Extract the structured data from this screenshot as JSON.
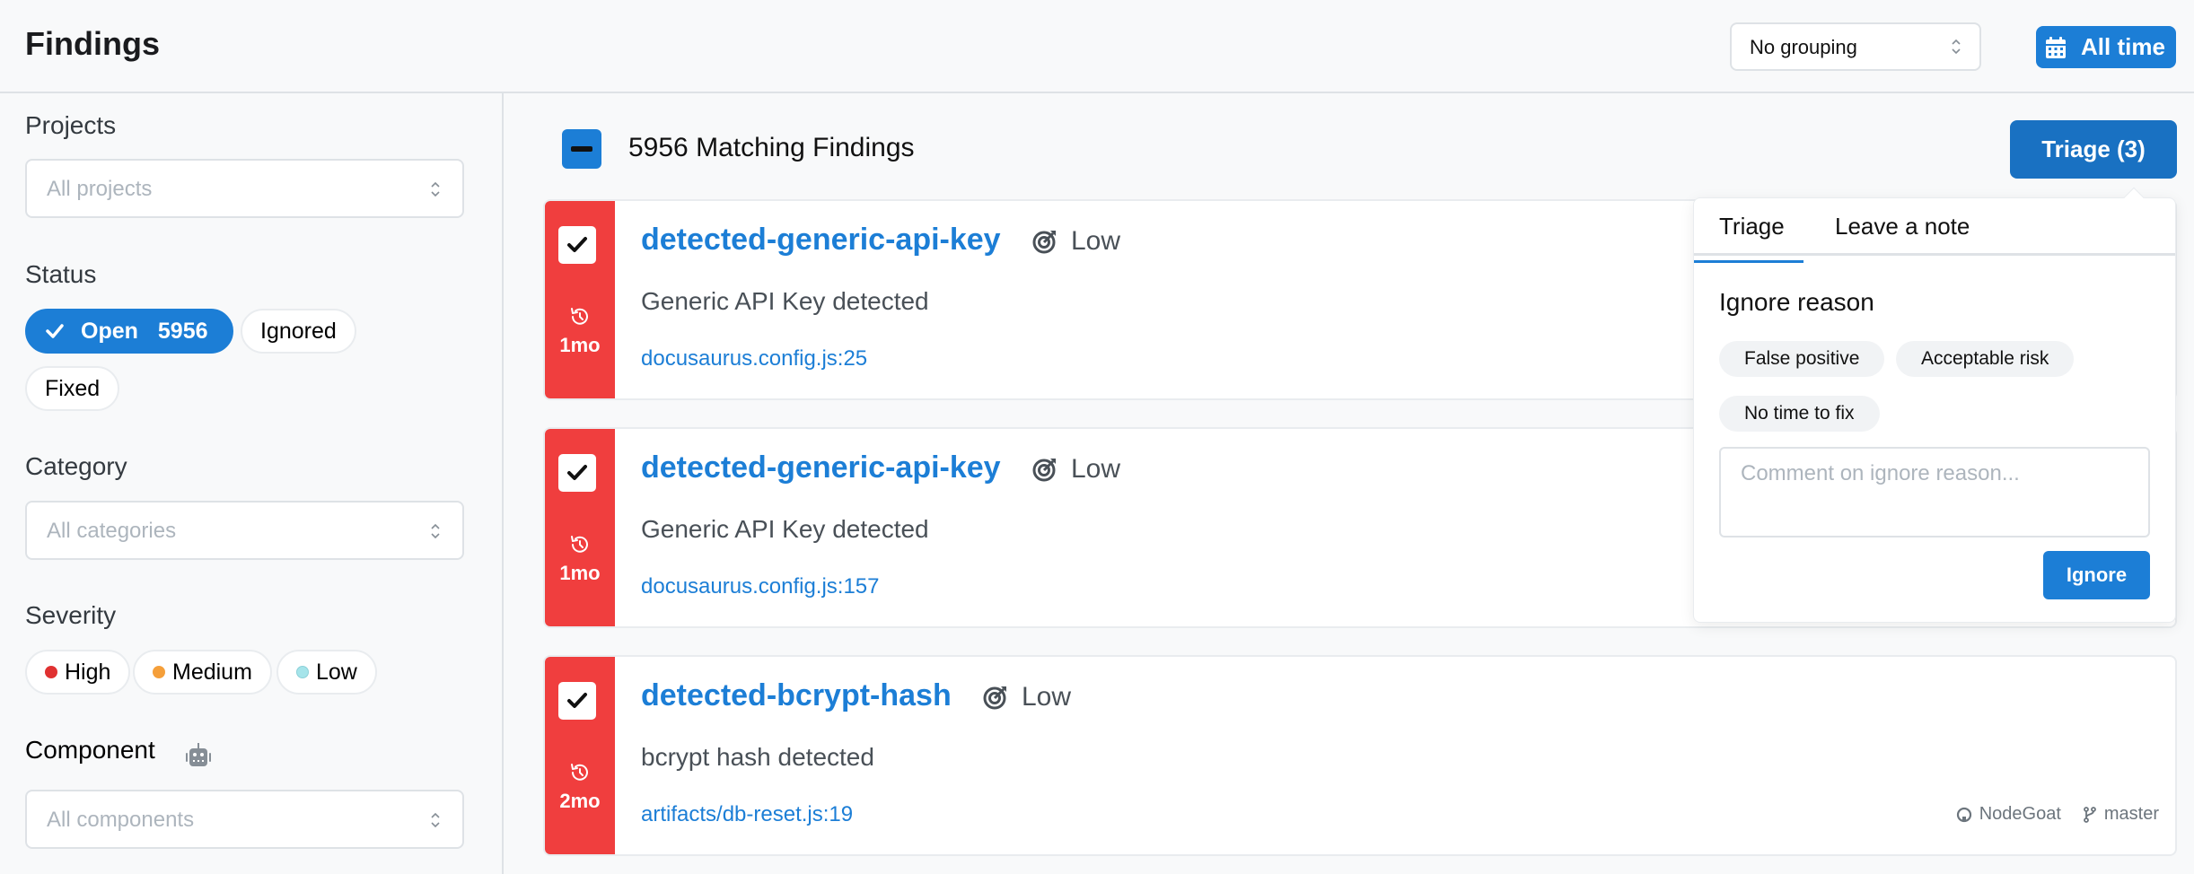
{
  "header": {
    "title": "Findings",
    "grouping": {
      "value": "No grouping"
    },
    "time_range": {
      "label": "All time",
      "icon": "calendar-icon"
    }
  },
  "sidebar": {
    "projects": {
      "label": "Projects",
      "placeholder": "All projects"
    },
    "status": {
      "label": "Status",
      "options": [
        {
          "label": "Open",
          "count": "5956",
          "selected": true
        },
        {
          "label": "Ignored",
          "selected": false
        },
        {
          "label": "Fixed",
          "selected": false
        }
      ]
    },
    "category": {
      "label": "Category",
      "placeholder": "All categories"
    },
    "severity": {
      "label": "Severity",
      "options": [
        {
          "label": "High",
          "color": "#e03131"
        },
        {
          "label": "Medium",
          "color": "#f59f00"
        },
        {
          "label": "Low",
          "color": "#99e9f2"
        }
      ]
    },
    "component": {
      "label": "Component",
      "icon": "robot-icon",
      "placeholder": "All components"
    }
  },
  "main": {
    "matching_count": "5956 Matching Findings",
    "triage_button": "Triage (3)",
    "findings": [
      {
        "rule": "detected-generic-api-key",
        "severity": "Low",
        "description": "Generic API Key detected",
        "location": "docusaurus.config.js:25",
        "age": "1mo",
        "checked": true
      },
      {
        "rule": "detected-generic-api-key",
        "severity": "Low",
        "description": "Generic API Key detected",
        "location": "docusaurus.config.js:157",
        "age": "1mo",
        "checked": true
      },
      {
        "rule": "detected-bcrypt-hash",
        "severity": "Low",
        "description": "bcrypt hash detected",
        "location": "artifacts/db-reset.js:19",
        "age": "2mo",
        "checked": true,
        "repo": "NodeGoat",
        "branch": "master"
      }
    ]
  },
  "popover": {
    "tabs": [
      {
        "label": "Triage",
        "active": true
      },
      {
        "label": "Leave a note",
        "active": false
      }
    ],
    "ignore_reason_title": "Ignore reason",
    "reasons": [
      "False positive",
      "Acceptable risk",
      "No time to fix"
    ],
    "comment_placeholder": "Comment on ignore reason...",
    "ignore_button": "Ignore"
  },
  "colors": {
    "accent": "#1c7ed6",
    "finding_stripe": "#f03e3e"
  }
}
